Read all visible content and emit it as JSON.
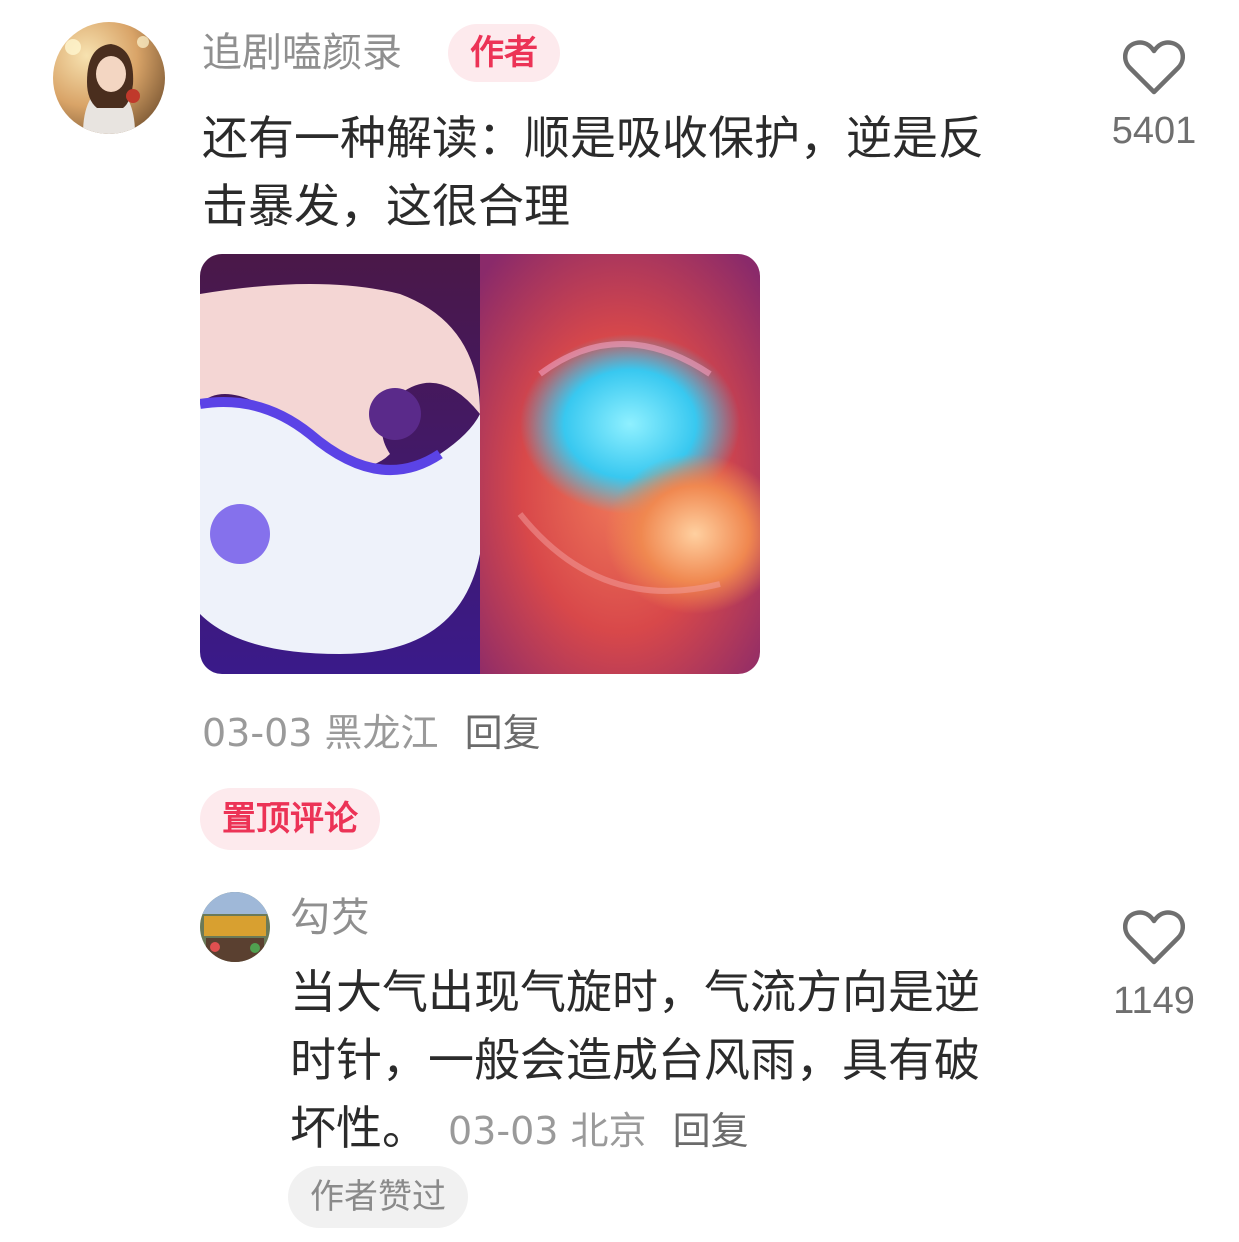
{
  "main_comment": {
    "username": "追剧嗑颜录",
    "author_badge": "作者",
    "text": "还有一种解读：顺是吸收保护，逆是反击暴发，这很合理",
    "text_line1": "还有一种解读：顺是吸收保护，逆是反",
    "text_line2": "击暴发，这很合理",
    "like_count": "5401",
    "date": "03-03",
    "location": "黑龙江",
    "reply_label": "回复",
    "pinned_label": "置顶评论",
    "avatar_icon": "user-avatar-girl"
  },
  "reply_comment": {
    "username": "勾芡",
    "text_line1": "当大气出现气旋时，气流方向是逆",
    "text_line2": "时针，一般会造成台风雨，具有破",
    "text_line3": "坏性。",
    "like_count": "1149",
    "date": "03-03",
    "location": "北京",
    "reply_label": "回复",
    "author_liked_label": "作者赞过",
    "avatar_icon": "user-avatar-shop"
  },
  "colors": {
    "accent": "#ec3356",
    "badge_bg": "#fdeaed",
    "muted_text": "#9a9a9a"
  }
}
